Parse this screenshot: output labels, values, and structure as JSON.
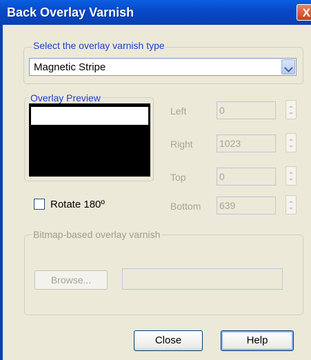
{
  "window": {
    "title": "Back Overlay Varnish",
    "close_glyph": "X"
  },
  "type_group": {
    "legend": "Select the overlay varnish type",
    "selected": "Magnetic Stripe"
  },
  "preview_group": {
    "legend": "Overlay Preview"
  },
  "fields": {
    "left": {
      "label": "Left",
      "value": "0"
    },
    "right": {
      "label": "Right",
      "value": "1023"
    },
    "top": {
      "label": "Top",
      "value": "0"
    },
    "bottom": {
      "label": "Bottom",
      "value": "639"
    }
  },
  "rotate": {
    "label": "Rotate 180º",
    "checked": false
  },
  "bitmap_group": {
    "legend": "Bitmap-based overlay varnish",
    "browse_label": "Browse...",
    "path_value": ""
  },
  "buttons": {
    "close": "Close",
    "help": "Help"
  },
  "icons": {
    "select_arrow": "chevron-down-icon",
    "spin_up": "spin-up-icon",
    "spin_down": "spin-down-icon",
    "close": "close-icon"
  },
  "colors": {
    "titlebar": "#0a4fd0",
    "dialog_bg": "#ece9d8",
    "legend_active": "#1a3fd0",
    "disabled_text": "#a7a598"
  }
}
